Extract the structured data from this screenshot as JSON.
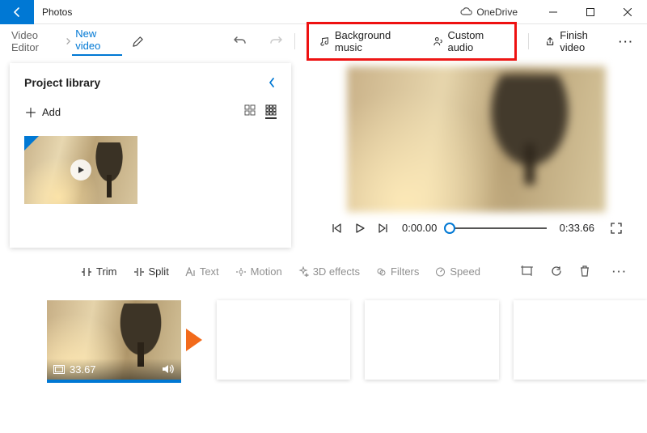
{
  "window": {
    "app_title": "Photos",
    "onedrive_label": "OneDrive"
  },
  "breadcrumb": {
    "root": "Video Editor",
    "current": "New video"
  },
  "toolbar": {
    "bg_music": "Background music",
    "custom_audio": "Custom audio",
    "finish": "Finish video"
  },
  "library": {
    "title": "Project library",
    "add_label": "Add"
  },
  "player": {
    "current_time": "0:00.00",
    "total_time": "0:33.66"
  },
  "clip_tools": {
    "trim": "Trim",
    "split": "Split",
    "text": "Text",
    "motion": "Motion",
    "effects": "3D effects",
    "filters": "Filters",
    "speed": "Speed"
  },
  "storyboard": {
    "clip_duration": "33.67"
  }
}
